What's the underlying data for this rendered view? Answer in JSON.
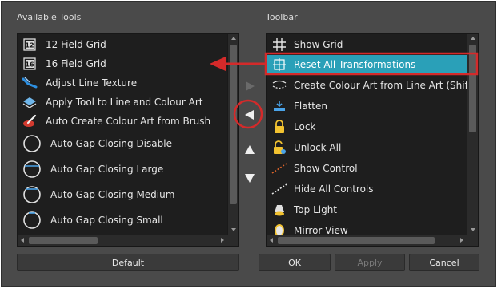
{
  "available_tools": {
    "label": "Available Tools",
    "items": [
      {
        "label": "12 Field Grid",
        "icon": "field-grid-12-icon"
      },
      {
        "label": "16 Field Grid",
        "icon": "field-grid-16-icon"
      },
      {
        "label": "Adjust Line Texture",
        "icon": "adjust-line-texture-icon"
      },
      {
        "label": "Apply Tool to Line and Colour Art",
        "icon": "apply-tool-icon"
      },
      {
        "label": "Auto Create Colour Art from Brush",
        "icon": "auto-create-colour-art-icon"
      },
      {
        "label": "Auto Gap Closing Disable",
        "icon": "gap-closing-disable-icon"
      },
      {
        "label": "Auto Gap Closing Large",
        "icon": "gap-closing-large-icon"
      },
      {
        "label": "Auto Gap Closing Medium",
        "icon": "gap-closing-medium-icon"
      },
      {
        "label": "Auto Gap Closing Small",
        "icon": "gap-closing-small-icon"
      }
    ]
  },
  "toolbar": {
    "label": "Toolbar",
    "items": [
      {
        "label": "Show Grid",
        "icon": "grid-icon"
      },
      {
        "label": "Reset All Transformations",
        "icon": "reset-transformations-icon",
        "selected": true
      },
      {
        "label": "Create Colour Art from Line Art (Shift Clic",
        "icon": "create-colour-art-icon"
      },
      {
        "label": "Flatten",
        "icon": "flatten-icon"
      },
      {
        "label": "Lock",
        "icon": "lock-icon"
      },
      {
        "label": "Unlock All",
        "icon": "unlock-all-icon"
      },
      {
        "label": "Show Control",
        "icon": "show-control-icon"
      },
      {
        "label": "Hide All Controls",
        "icon": "hide-controls-icon"
      },
      {
        "label": "Top Light",
        "icon": "top-light-icon"
      },
      {
        "label": "Mirror View",
        "icon": "mirror-view-icon"
      }
    ]
  },
  "buttons": {
    "default": "Default",
    "ok": "OK",
    "apply": "Apply",
    "cancel": "Cancel"
  },
  "colors": {
    "selection": "#2aa0b8",
    "annotation": "#d42a2a",
    "dialog_bg": "#4a4a4a",
    "list_bg": "#1e1e1e"
  }
}
